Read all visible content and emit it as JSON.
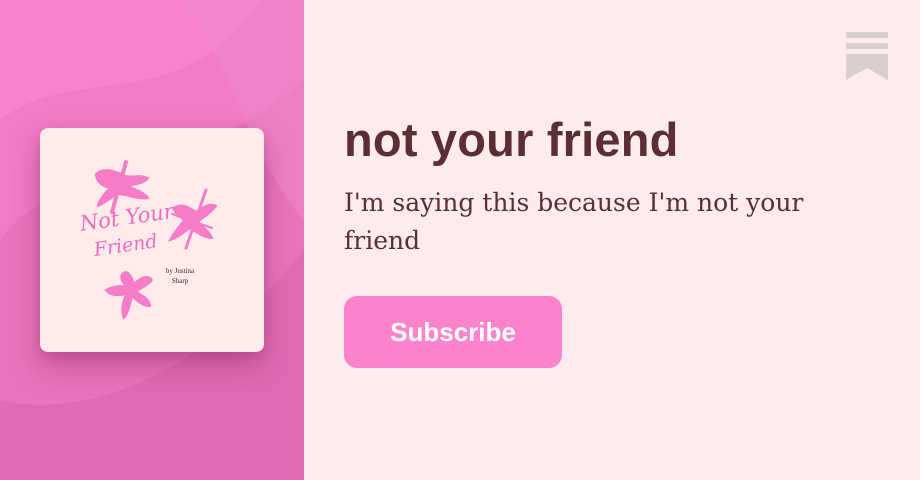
{
  "publication": {
    "title": "not your friend",
    "description": "I'm saying this because I'm not your friend",
    "subscribe_label": "Subscribe"
  },
  "cover": {
    "title_line_1": "Not Your",
    "title_line_2": "Friend",
    "author": "by Justina Sharp"
  },
  "icons": {
    "bookmark": "bookmark-icon"
  },
  "colors": {
    "page_background": "#feeced",
    "panel_pink": "#f984cc",
    "accent_pink": "#fd84cc",
    "title_text": "#5b2d34",
    "cover_background": "#feebea",
    "bookmark_gray": "#d8d0d0"
  }
}
